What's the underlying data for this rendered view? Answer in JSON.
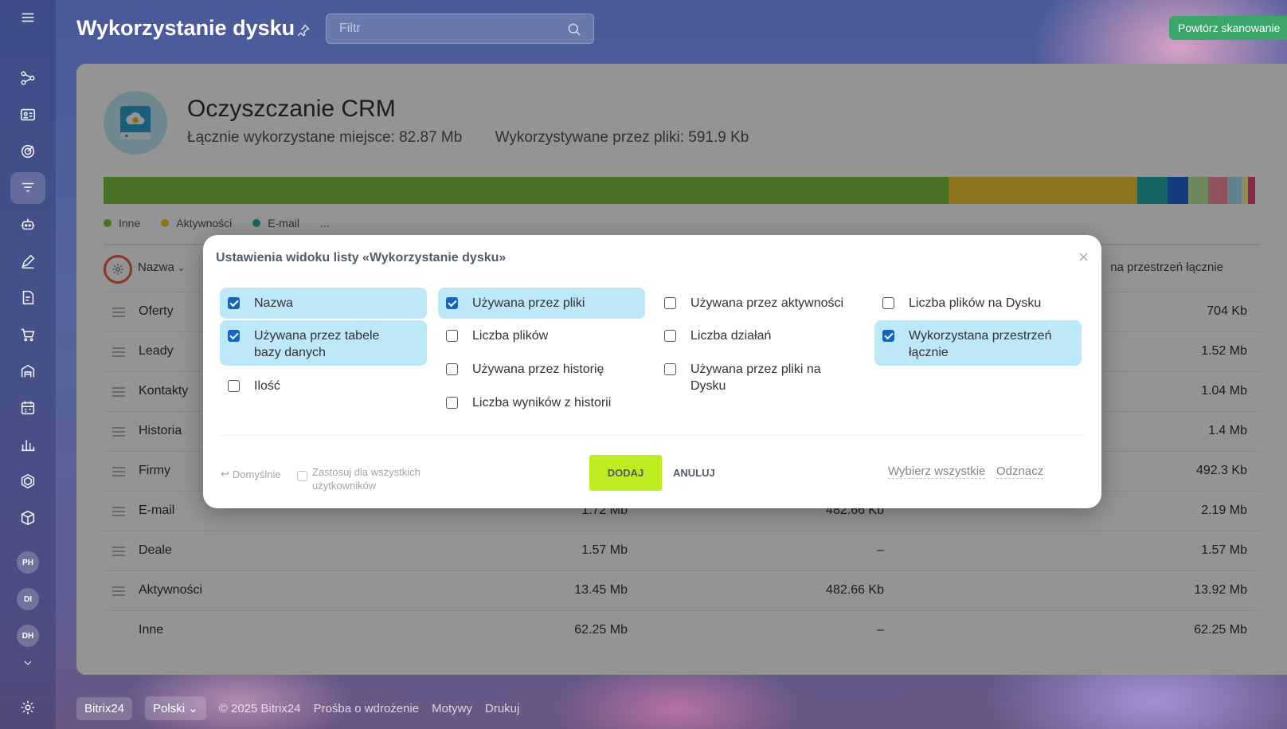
{
  "header": {
    "title": "Wykorzystanie dysku",
    "filter_placeholder": "Filtr",
    "rescan_label": "Powtórz skanowanie"
  },
  "sidebar": {
    "icons": [
      "menu-icon",
      "crm-flow-icon",
      "contact-card-icon",
      "target-icon",
      "funnel-icon",
      "robot-icon",
      "pen-icon",
      "document-edit-icon",
      "cart-icon",
      "warehouse-icon",
      "calendar-icon",
      "analytics-icon",
      "hexagon-icon",
      "package-icon"
    ],
    "avatars": [
      "PH",
      "DI",
      "DH"
    ]
  },
  "card": {
    "title": "Oczyszczanie CRM",
    "total_used": "Łącznie wykorzystane miejsce: 82.87 Mb",
    "files_used": "Wykorzystywane przez pliki: 591.9 Kb"
  },
  "usage_bar": [
    {
      "label": "Inne",
      "color": "#7fc241",
      "share": 0.731
    },
    {
      "label": "Aktywności",
      "color": "#f5c533",
      "share": 0.163
    },
    {
      "label": "E-mail",
      "color": "#25b0ab",
      "share": 0.026
    },
    {
      "label": "Deale",
      "color": "#2467d6",
      "share": 0.018
    },
    {
      "label": "Firmy",
      "color": "#bde9a2",
      "share": 0.017
    },
    {
      "label": "Historia",
      "color": "#f590a0",
      "share": 0.017
    },
    {
      "label": "Kontakty",
      "color": "#a8e0f6",
      "share": 0.012
    },
    {
      "label": "Leady",
      "color": "#f7f29c",
      "share": 0.006
    },
    {
      "label": "Oferty",
      "color": "#f0457d",
      "share": 0.006
    }
  ],
  "legend": [
    {
      "label": "Inne",
      "color": "#7fc241"
    },
    {
      "label": "Aktywności",
      "color": "#f5c533"
    },
    {
      "label": "E-mail",
      "color": "#25b0ab"
    }
  ],
  "legend_more": "...",
  "table": {
    "col_name": "Nazwa",
    "col_last": "na przestrzeń łącznie",
    "rows": [
      {
        "name": "Oferty",
        "c1": "",
        "c2": "",
        "c3": "704 Kb"
      },
      {
        "name": "Leady",
        "c1": "",
        "c2": "",
        "c3": "1.52 Mb"
      },
      {
        "name": "Kontakty",
        "c1": "",
        "c2": "",
        "c3": "1.04 Mb"
      },
      {
        "name": "Historia",
        "c1": "",
        "c2": "",
        "c3": "1.4 Mb"
      },
      {
        "name": "Firmy",
        "c1": "",
        "c2": "",
        "c3": "492.3 Kb"
      },
      {
        "name": "E-mail",
        "c1": "1.72 Mb",
        "c2": "482.66 Kb",
        "c3": "2.19 Mb"
      },
      {
        "name": "Deale",
        "c1": "1.57 Mb",
        "c2": "–",
        "c3": "1.57 Mb"
      },
      {
        "name": "Aktywności",
        "c1": "13.45 Mb",
        "c2": "482.66 Kb",
        "c3": "13.92 Mb"
      },
      {
        "name": "Inne",
        "c1": "62.25 Mb",
        "c2": "–",
        "c3": "62.25 Mb"
      }
    ]
  },
  "modal": {
    "title": "Ustawienia widoku listy «Wykorzystanie dysku»",
    "options": [
      {
        "label": "Nazwa",
        "checked": true
      },
      {
        "label": "Używana przez tabele bazy danych",
        "checked": true
      },
      {
        "label": "Ilość",
        "checked": false
      },
      {
        "label": "Używana przez pliki",
        "checked": true
      },
      {
        "label": "Liczba plików",
        "checked": false
      },
      {
        "label": "Używana przez historię",
        "checked": false
      },
      {
        "label": "Liczba wyników z historii",
        "checked": false
      },
      {
        "label": "Używana przez aktywności",
        "checked": false
      },
      {
        "label": "Liczba działań",
        "checked": false
      },
      {
        "label": "Używana przez pliki na Dysku",
        "checked": false
      },
      {
        "label": "Liczba plików na Dysku",
        "checked": false
      },
      {
        "label": "Wykorzystana przestrzeń łącznie",
        "checked": true
      }
    ],
    "default_label": "Domyślnie",
    "apply_all_label": "Zastosuj dla wszystkich użytkowników",
    "add_label": "DODAJ",
    "cancel_label": "ANULUJ",
    "select_all_label": "Wybierz wszystkie",
    "deselect_label": "Odznacz"
  },
  "footer": {
    "brand": "Bitrix24",
    "language": "Polski",
    "copyright": "© 2025 Bitrix24",
    "links": [
      "Prośba o wdrożenie",
      "Motywy",
      "Drukuj"
    ]
  }
}
